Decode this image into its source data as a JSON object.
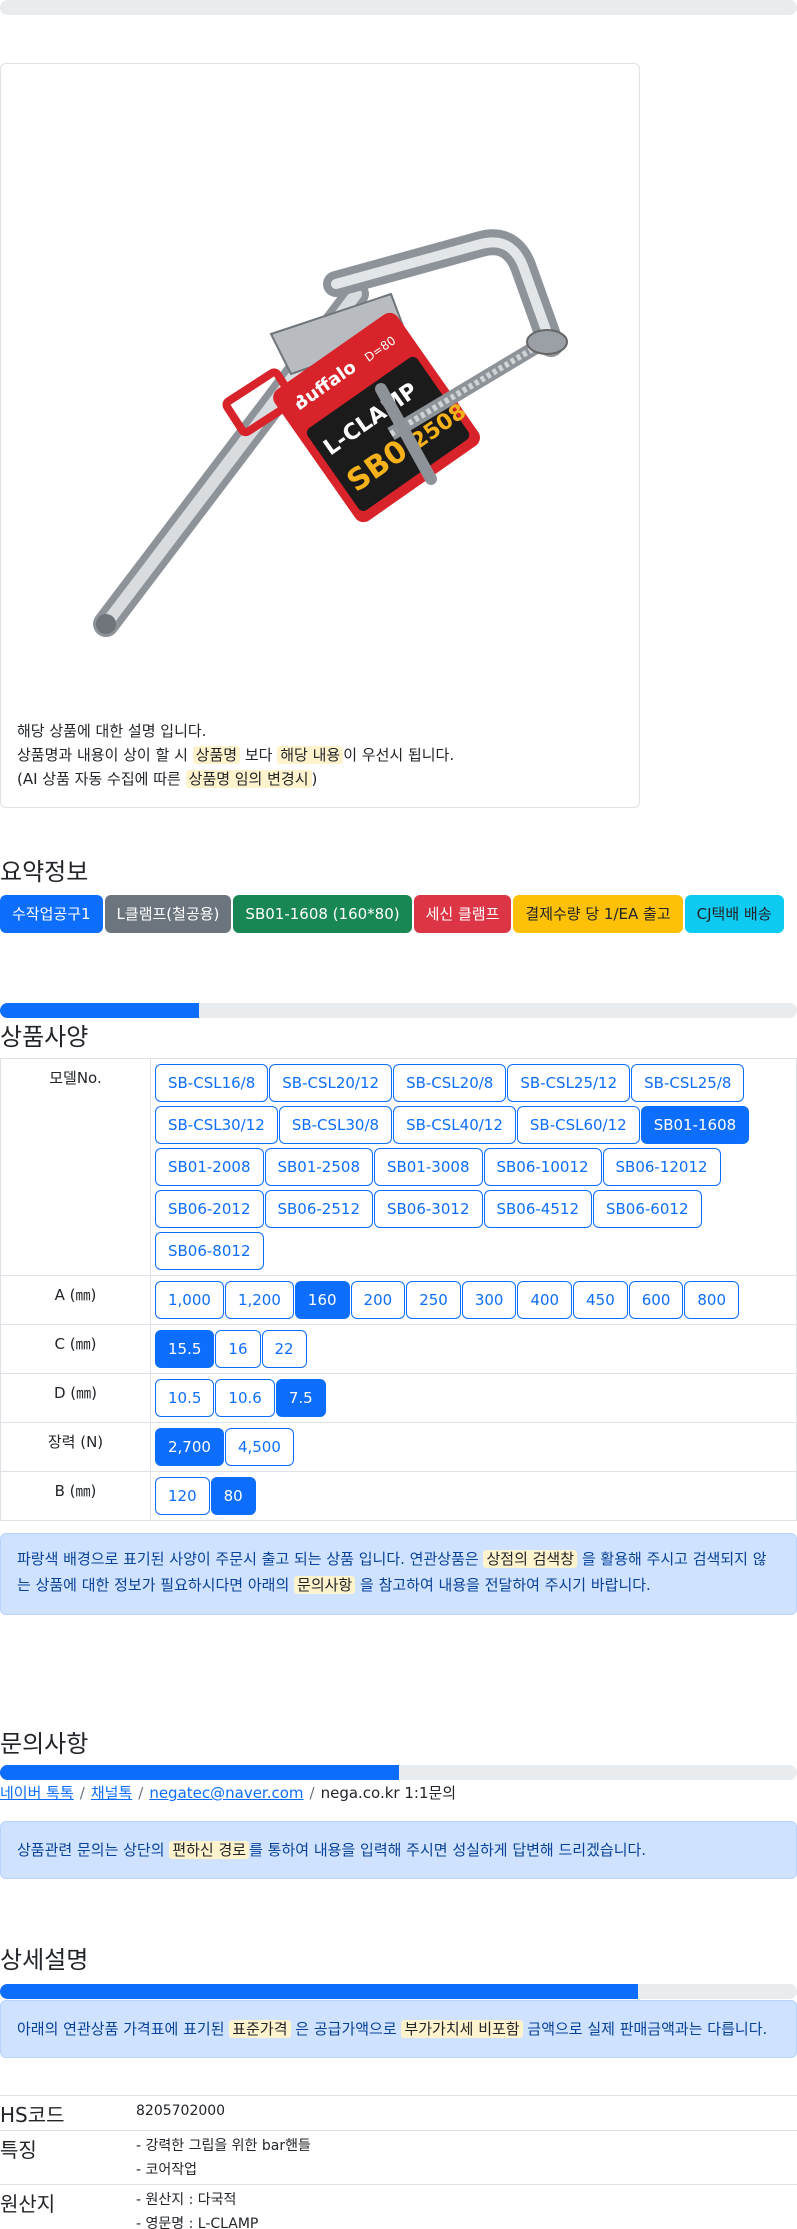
{
  "product": {
    "description_lines": {
      "line1": "해당 상품에 대한 설명 입니다.",
      "line2_a": "상품명과 내용이 상이 할 시",
      "line2_hl1": "상품명",
      "line2_b": "보다",
      "line2_hl2": "해당 내용",
      "line2_c": "이 우선시 됩니다.",
      "line3_a": "(AI 상품 자동 수집에 따른",
      "line3_hl": "상품명 임의 변경시",
      "line3_b": ")"
    },
    "image_label": {
      "brand": "Buffalo",
      "type": "L-CLAMP",
      "model": "SB0",
      "series": "2508",
      "sub": "D=80"
    }
  },
  "summary": {
    "title": "요약정보",
    "badges": [
      "수작업공구1",
      "L클램프(철공용)",
      "SB01-1608 (160*80)",
      "세신 클램프",
      "결제수량 당 1/EA 출고",
      "CJ택배 배송"
    ]
  },
  "specs": {
    "title": "상품사양",
    "progress": 0.25,
    "rows": [
      {
        "label": "모델No.",
        "options": [
          "SB-CSL16/8",
          "SB-CSL20/12",
          "SB-CSL20/8",
          "SB-CSL25/12",
          "SB-CSL25/8",
          "SB-CSL30/12",
          "SB-CSL30/8",
          "SB-CSL40/12",
          "SB-CSL60/12",
          "SB01-1608",
          "SB01-2008",
          "SB01-2508",
          "SB01-3008",
          "SB06-10012",
          "SB06-12012",
          "SB06-2012",
          "SB06-2512",
          "SB06-3012",
          "SB06-4512",
          "SB06-6012",
          "SB06-8012"
        ],
        "active": "SB01-1608"
      },
      {
        "label": "A (㎜)",
        "options": [
          "1,000",
          "1,200",
          "160",
          "200",
          "250",
          "300",
          "400",
          "450",
          "600",
          "800"
        ],
        "active": "160"
      },
      {
        "label": "C (㎜)",
        "options": [
          "15.5",
          "16",
          "22"
        ],
        "active": "15.5"
      },
      {
        "label": "D (㎜)",
        "options": [
          "10.5",
          "10.6",
          "7.5"
        ],
        "active": "7.5"
      },
      {
        "label": "장력 (N)",
        "options": [
          "2,700",
          "4,500"
        ],
        "active": "2,700"
      },
      {
        "label": "B (㎜)",
        "options": [
          "120",
          "80"
        ],
        "active": "80"
      }
    ],
    "notice": {
      "a": "파랑색 배경으로 표기된 사양이 주문시 출고 되는 상품 입니다. 연관상품은",
      "hl1": "상점의 검색창",
      "b": "을 활용해 주시고 검색되지 않는 상품에 대한 정보가 필요하시다면 아래의",
      "hl2": "문의사항",
      "c": "을 참고하여 내용을 전달하여 주시기 바랍니다."
    }
  },
  "inquiry": {
    "title": "문의사항",
    "progress": 0.5,
    "links": [
      "네이버 톡톡",
      "채널톡",
      "negatec@naver.com"
    ],
    "plain_link": "nega.co.kr 1:1문의",
    "notice": {
      "a": "상품관련 문의는 상단의",
      "hl": "편하신 경로",
      "b": "를 통하여 내용을 입력해 주시면 성실하게 답변해 드리겠습니다."
    }
  },
  "detail": {
    "title": "상세설명",
    "progress": 0.8,
    "notice": {
      "a": "아래의 연관상품 가격표에 표기된",
      "hl1": "표준가격",
      "b": "은 공급가액으로",
      "hl2": "부가가치세 비포함",
      "c": "금액으로 실제 판매금액과는 다릅니다."
    },
    "info": [
      {
        "key": "HS코드",
        "values": [
          "8205702000"
        ]
      },
      {
        "key": "특징",
        "values": [
          "- 강력한 그립을 위한 bar핸들",
          "- 코어작업"
        ]
      },
      {
        "key": "원산지",
        "values": [
          "- 원산지 : 다국적",
          "- 영문명 : L-CLAMP"
        ]
      }
    ]
  }
}
